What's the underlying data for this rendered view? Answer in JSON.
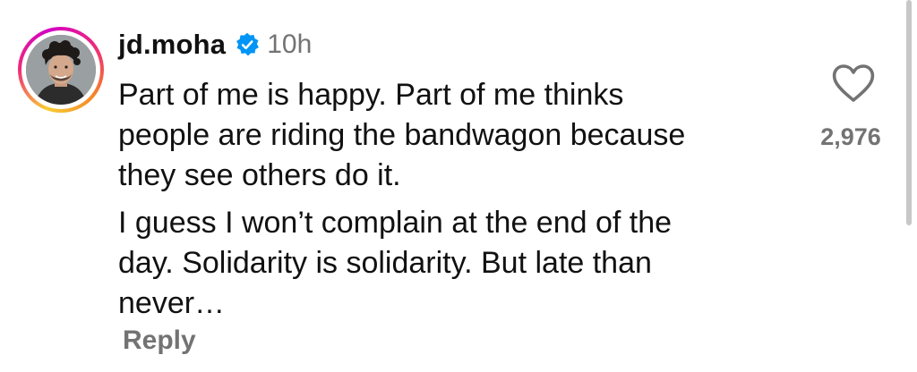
{
  "comment": {
    "username": "jd.moha",
    "verified": true,
    "time": "10h",
    "paragraphs": [
      "Part of me is happy. Part of me thinks\npeople are riding the bandwagon because\nthey see others do it.",
      "I guess I won’t complain at the end of the\nday. Solidarity is solidarity. But late than\nnever…"
    ],
    "reply_label": "Reply",
    "like_count": "2,976"
  },
  "icons": {
    "avatar": "profile-photo",
    "verified": "verified-badge-icon",
    "like": "heart-outline-icon"
  },
  "colors": {
    "text": "#111111",
    "muted": "#737373",
    "verified_blue": "#0095f6"
  }
}
